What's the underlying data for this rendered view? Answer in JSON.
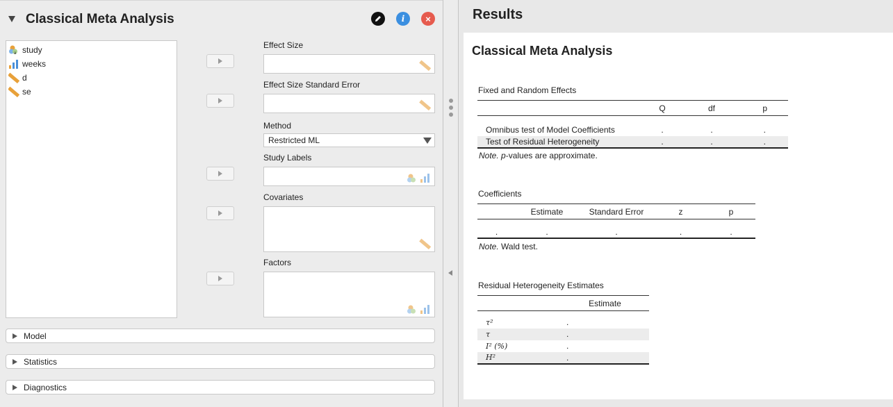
{
  "left": {
    "title": "Classical Meta Analysis",
    "info_glyph": "i",
    "close_glyph": "×",
    "variables": [
      {
        "name": "study",
        "icon": "nominal-text-icon"
      },
      {
        "name": "weeks",
        "icon": "ordinal-icon"
      },
      {
        "name": "d",
        "icon": "scale-ruler-icon"
      },
      {
        "name": "se",
        "icon": "scale-ruler-icon"
      }
    ],
    "fields": {
      "effect_size": "Effect Size",
      "effect_size_se": "Effect Size Standard Error",
      "method": "Method",
      "method_value": "Restricted ML",
      "study_labels": "Study Labels",
      "covariates": "Covariates",
      "factors": "Factors"
    },
    "sections": [
      "Model",
      "Statistics",
      "Diagnostics"
    ]
  },
  "results": {
    "title": "Results",
    "heading": "Classical Meta Analysis",
    "fixed_random": {
      "title": "Fixed and Random Effects",
      "columns": [
        "",
        "Q",
        "df",
        "p"
      ],
      "rows": [
        {
          "label": "Omnibus test of Model Coefficients",
          "q": ".",
          "df": ".",
          "p": "."
        },
        {
          "label": "Test of Residual Heterogeneity",
          "q": ".",
          "df": ".",
          "p": "."
        }
      ],
      "note_prefix": "Note.",
      "note_p": "p",
      "note_rest": "-values are approximate."
    },
    "coefficients": {
      "title": "Coefficients",
      "columns": [
        "",
        "Estimate",
        "Standard Error",
        "z",
        "p"
      ],
      "row": [
        ".",
        ".",
        ".",
        ".",
        "."
      ],
      "note_prefix": "Note.",
      "note_rest": "Wald test."
    },
    "residual": {
      "title": "Residual Heterogeneity Estimates",
      "column": "Estimate",
      "rows": [
        {
          "label": "τ²",
          "value": "."
        },
        {
          "label": "τ",
          "value": "."
        },
        {
          "label": "I² (%)",
          "value": "."
        },
        {
          "label": "H²",
          "value": "."
        }
      ]
    }
  },
  "colors": {
    "info": "#3b8fe0",
    "close": "#e65b4e",
    "edit": "#111111",
    "ruler": "#e8a13a",
    "ordinal": "#4a90d9"
  }
}
